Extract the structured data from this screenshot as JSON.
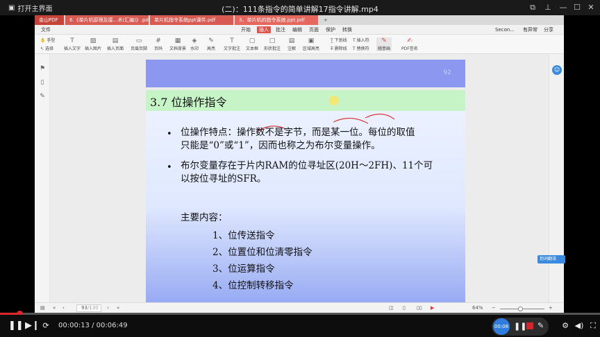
{
  "player": {
    "open_home": "打开主界面",
    "title": "(二)：111条指令的简单讲解17指令讲解.mp4",
    "current_time": "00:00:13",
    "duration": "00:06:49",
    "time_separator": " / ",
    "progress": 0.032,
    "rec_timer": "00:08",
    "accent_color": "#e0262b"
  },
  "wps": {
    "brand": "金山PDF",
    "tabs": [
      {
        "label": "6.《单片机原理及接...术(汇编)》.pdf"
      },
      {
        "label": "单片机指令系统ppt课件.pdf"
      },
      {
        "label": "3、单片机的指令系统.ppt.pdf"
      }
    ],
    "file_menu": "文件",
    "menus": [
      "开始",
      "插入",
      "批注",
      "编辑",
      "页面",
      "保护",
      "转换"
    ],
    "active_menu": "插入",
    "right_buttons": [
      "有异常",
      "分享"
    ],
    "user": "Secon...",
    "tools": [
      "手型",
      "选择",
      "插入文字",
      "插入图片",
      "插入页面",
      "页眉页脚",
      "页码",
      "文档背景",
      "水印",
      "高亮",
      "文字批注",
      "文本框",
      "形状批注",
      "注解",
      "区域高亮",
      "下划线",
      "删除线",
      "插入符",
      "替换符",
      "随意画",
      "PDF签名"
    ],
    "page_input": "93",
    "page_total": "/130",
    "zoom": "64%",
    "translate_badge": "划词翻译"
  },
  "slide": {
    "prev_page_number": "92",
    "heading": "3.7 位操作指令",
    "bullets": [
      [
        "位操作特点：操作数不是字节，而是某一位。每位的取值",
        "只能是“0”或“1”，因而也称之为布尔变量操作。"
      ],
      [
        "布尔变量存在于片内RAM的位寻址区(20H～2FH)、11个可",
        "以按位寻址的SFR。"
      ]
    ],
    "main_label": "主要内容：",
    "items": [
      "1、位传送指令",
      "2、位置位和位清零指令",
      "3、位运算指令",
      "4、位控制转移指令"
    ]
  }
}
